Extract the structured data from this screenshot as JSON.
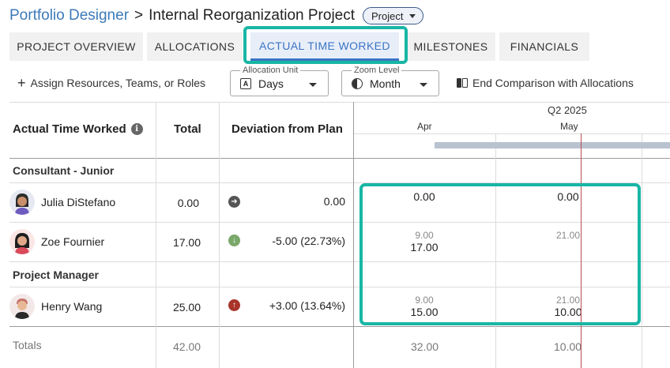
{
  "breadcrumb": {
    "root": "Portfolio Designer",
    "separator": ">",
    "title": "Internal Reorganization Project",
    "type_badge": "Project"
  },
  "tabs": [
    {
      "label": "PROJECT OVERVIEW",
      "active": false
    },
    {
      "label": "ALLOCATIONS",
      "active": false
    },
    {
      "label": "ACTUAL TIME WORKED",
      "active": true
    },
    {
      "label": "MILESTONES",
      "active": false
    },
    {
      "label": "FINANCIALS",
      "active": false
    }
  ],
  "toolbar": {
    "assign_label": "Assign Resources, Teams, or Roles",
    "allocation_unit": {
      "legend": "Allocation Unit",
      "value": "Days"
    },
    "zoom_level": {
      "legend": "Zoom Level",
      "value": "Month"
    },
    "end_comparison_label": "End Comparison with Allocations"
  },
  "table": {
    "headers": {
      "name": "Actual Time Worked",
      "total": "Total",
      "deviation": "Deviation from Plan"
    },
    "timeline": {
      "quarter": "Q2 2025",
      "months": [
        "Apr",
        "May"
      ]
    },
    "groups": [
      {
        "label": "Consultant - Junior",
        "rows": [
          {
            "name": "Julia DiStefano",
            "total": "0.00",
            "deviation": "0.00",
            "trend": "neutral",
            "apr_plan": "",
            "apr_actual": "0.00",
            "may_plan": "",
            "may_actual": "0.00"
          },
          {
            "name": "Zoe Fournier",
            "total": "17.00",
            "deviation": "-5.00 (22.73%)",
            "trend": "down",
            "apr_plan": "9.00",
            "apr_actual": "17.00",
            "may_plan": "21.00",
            "may_actual": ""
          }
        ]
      },
      {
        "label": "Project Manager",
        "rows": [
          {
            "name": "Henry Wang",
            "total": "25.00",
            "deviation": "+3.00 (13.64%)",
            "trend": "up",
            "apr_plan": "9.00",
            "apr_actual": "15.00",
            "may_plan": "21.00",
            "may_actual": "10.00"
          }
        ]
      }
    ],
    "totals": {
      "label": "Totals",
      "total": "42.00",
      "apr": "32.00",
      "may": "10.00"
    }
  },
  "colors": {
    "accent": "#3a74c4",
    "highlight": "#19b6a5",
    "trend_neutral": "#555555",
    "trend_down": "#7aa86a",
    "trend_up": "#a8342a",
    "today_line": "#b85050"
  }
}
